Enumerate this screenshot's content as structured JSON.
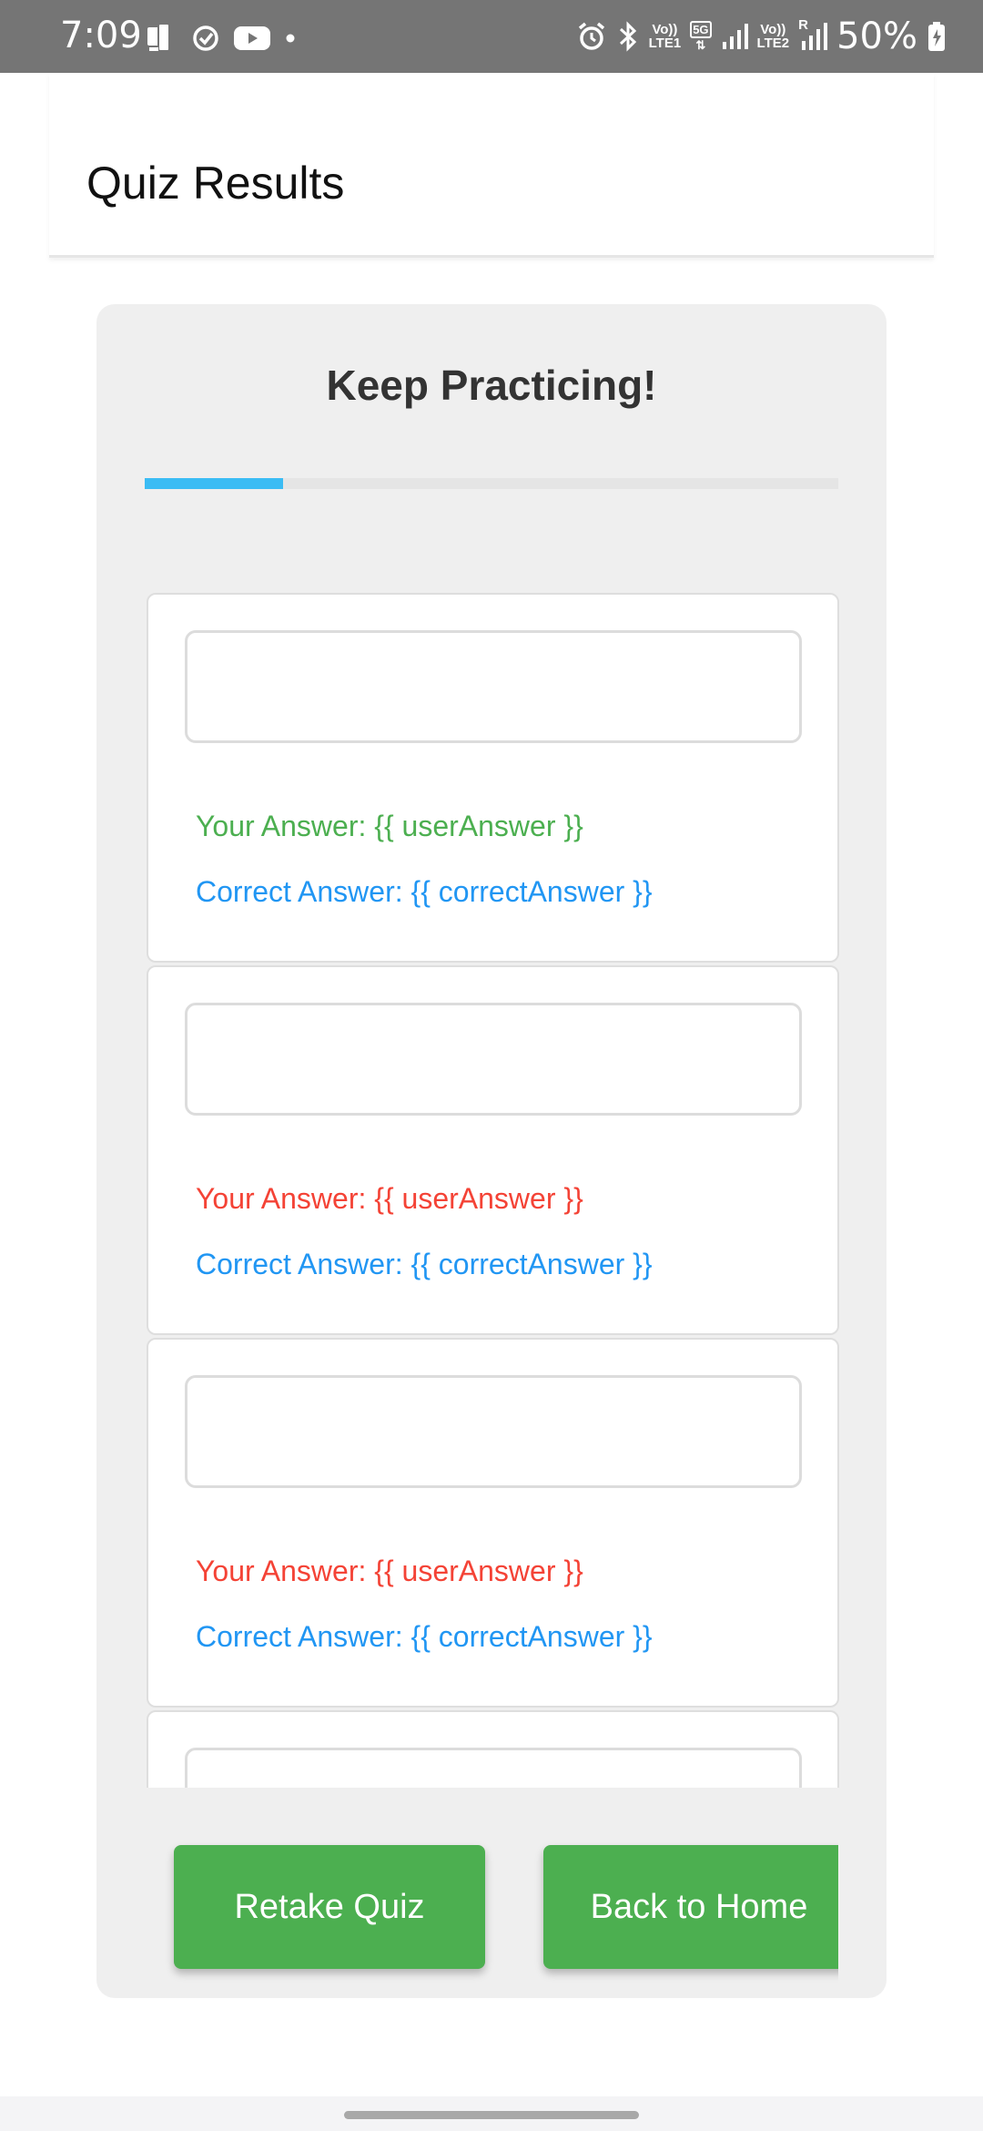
{
  "status_bar": {
    "time": "7:09",
    "battery_text": "50%",
    "sim1_top": "Vo))",
    "sim1_bottom": "LTE1",
    "network_5g": "5G",
    "sim2_top": "Vo))",
    "sim2_bottom": "LTE2",
    "roaming": "R"
  },
  "header": {
    "title": "Quiz Results"
  },
  "result": {
    "title": "Keep Practicing!",
    "progress_fraction": 0.2
  },
  "questions": [
    {
      "question": "",
      "user_answer": "Your Answer: {{ userAnswer }}",
      "correct_answer": "Correct Answer: {{ correctAnswer }}",
      "status": "correct"
    },
    {
      "question": "",
      "user_answer": "Your Answer: {{ userAnswer }}",
      "correct_answer": "Correct Answer: {{ correctAnswer }}",
      "status": "incorrect"
    },
    {
      "question": "",
      "user_answer": "Your Answer: {{ userAnswer }}",
      "correct_answer": "Correct Answer: {{ correctAnswer }}",
      "status": "incorrect"
    },
    {
      "question": "",
      "user_answer": "",
      "correct_answer": "",
      "status": ""
    }
  ],
  "buttons": {
    "retake": "Retake Quiz",
    "home": "Back to Home"
  },
  "colors": {
    "correct": "#4caf50",
    "incorrect": "#f44336",
    "correct_answer": "#2196f3",
    "progress": "#3bbcf4",
    "button": "#4caf50"
  }
}
